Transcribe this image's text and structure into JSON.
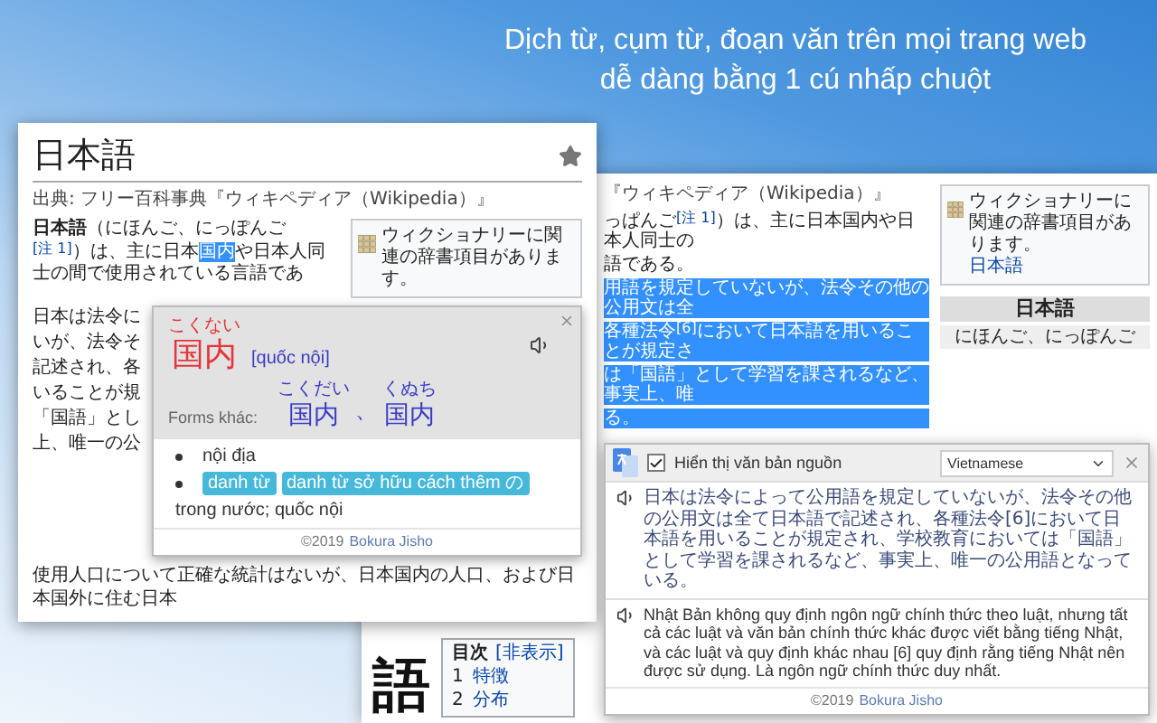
{
  "headline": {
    "lines": [
      "Dịch từ, cụm từ, đoạn văn trên mọi trang web",
      "dễ dàng bằng 1 cú nhấp chuột"
    ]
  },
  "left_page": {
    "title": "日本語",
    "source": "出典: フリー百科事典『ウィキペディア（Wikipedia）』",
    "intro": [
      {
        "text": "**日本語**（にほんご、にっぽんご$^{[注 1]}$）は、主に日本",
        "selected": false
      },
      {
        "text": "国内",
        "selected": true
      },
      {
        "text": "や日本人同士の間で使用されている言語であ",
        "selected": false
      }
    ],
    "wiktionary": {
      "text": "ウィクショナリーに関連の辞書項目があります。"
    },
    "fragments": [
      "日本は法令に",
      "いが、法令そ",
      "記述され、各",
      "いることが規",
      "「国語」とし",
      "上、唯一の公"
    ],
    "popup": {
      "word": "国内",
      "kana": "こくない",
      "reading": "[quốc nội]",
      "forms_label": "Forms khác:",
      "forms_separator": "、",
      "forms": [
        {
          "word": "国内",
          "kana": "こくだい"
        },
        {
          "word": "国内",
          "kana": "くぬち"
        }
      ],
      "meanings": [
        {
          "text": "nội địa"
        },
        {
          "tags": [
            "danh từ",
            "danh từ sở hữu cách thêm の"
          ],
          "text": "trong nước; quốc nội"
        }
      ],
      "footer": {
        "copyright": "©2019",
        "link": "Bokura Jisho"
      }
    },
    "closing_text": "使用人口について正確な統計はないが、日本国内の人口、および日本国外に住む日本"
  },
  "right_page": {
    "source": "『ウィキペディア（Wikipedia）』",
    "lines": [
      {
        "text": "っぱんご$^{[注 1]}$）は、主に日本国内や日本人同士の",
        "selected": false
      },
      {
        "text": "語である。",
        "selected": false
      },
      {
        "text": "用語を規定していないが、法令その他の公用文は全",
        "selected": true
      },
      {
        "text": "各種法令$^{[6]}$において日本語を用いることが規定さ",
        "selected": true
      },
      {
        "text": "は「国語」として学習を課されるなど、事実上、唯",
        "selected": true
      },
      {
        "text": "る。",
        "selected": true
      }
    ],
    "wiktionary": {
      "text": "ウィクショナリーに関連の辞書項目があります。",
      "link": "日本語"
    },
    "infobox": {
      "title": "日本語",
      "reading": "にほんご、にっぽんご"
    },
    "calligraphy": "語",
    "toc": {
      "title": "目次",
      "toggle": "[非表示]",
      "items": [
        {
          "number": "1",
          "label": "特徴"
        },
        {
          "number": "2",
          "label": "分布"
        }
      ]
    }
  },
  "translate_popup": {
    "show_source": true,
    "show_source_label": "Hiển thị văn bản nguồn",
    "language": "Vietnamese",
    "source_text": "日本は法令によって公用語を規定していないが、法令その他の公用文は全て日本語で記述され、各種法令[6]において日本語を用いることが規定され、学校教育においては「国語」として学習を課されるなど、事実上、唯一の公用語となっている。",
    "translation": "Nhật Bản không quy định ngôn ngữ chính thức theo luật, nhưng tất cả các luật và văn bản chính thức khác được viết bằng tiếng Nhật, và các luật và quy định khác nhau [6] quy định rằng tiếng Nhật nên được sử dụng. Là ngôn ngữ chính thức duy nhất.",
    "footer": {
      "copyright": "©2019",
      "link": "Bokura Jisho"
    }
  }
}
